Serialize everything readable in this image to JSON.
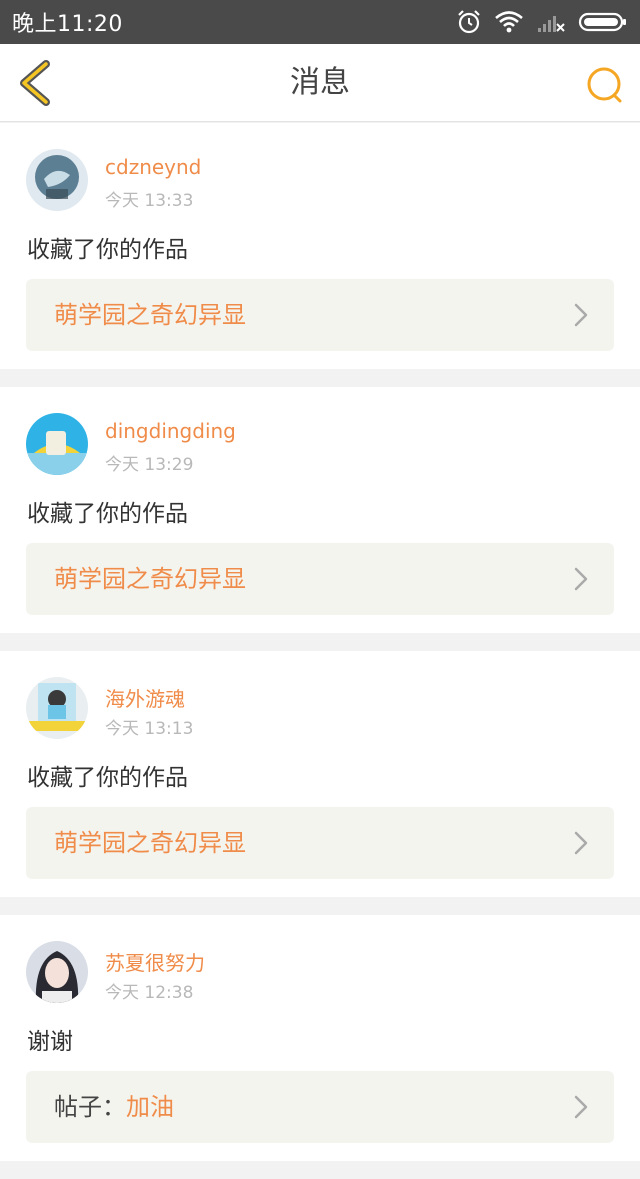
{
  "status_bar": {
    "time": "晚上11:20",
    "icons": [
      "alarm-icon",
      "wifi-icon",
      "signal-icon",
      "battery-icon"
    ]
  },
  "header": {
    "title": "消息",
    "back_icon": "chevron-left-icon",
    "search_icon": "search-icon",
    "accent_color": "#f5a623"
  },
  "messages": [
    {
      "username": "cdzneynd",
      "time": "今天 13:33",
      "action": "收藏了你的作品",
      "target_prefix": "",
      "target_title": "萌学园之奇幻异显"
    },
    {
      "username": "dingdingding",
      "time": "今天 13:29",
      "action": "收藏了你的作品",
      "target_prefix": "",
      "target_title": "萌学园之奇幻异显"
    },
    {
      "username": "海外游魂",
      "time": "今天 13:13",
      "action": "收藏了你的作品",
      "target_prefix": "",
      "target_title": "萌学园之奇幻异显"
    },
    {
      "username": "苏夏很努力",
      "time": "今天 12:38",
      "action": "谢谢",
      "target_prefix": "帖子：",
      "target_title": "加油"
    }
  ],
  "colors": {
    "username": "#f08c4a",
    "link_text": "#f08c4a",
    "link_bg": "#f4f4ef",
    "status_bar": "#4a4a4a"
  }
}
